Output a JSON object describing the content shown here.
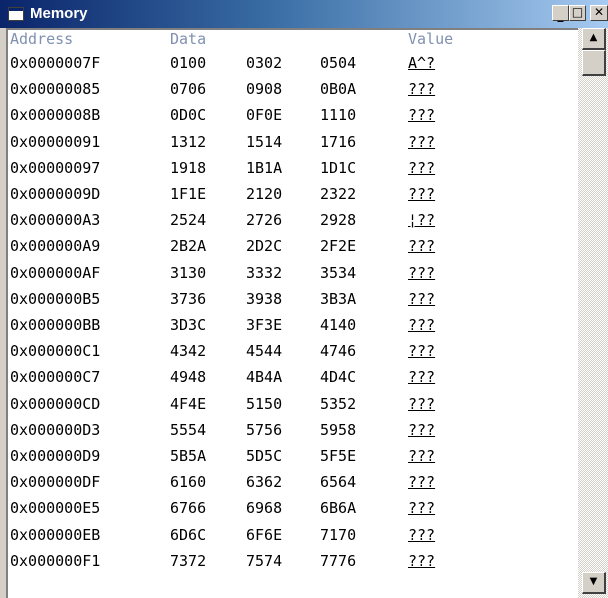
{
  "window": {
    "title": "Memory",
    "minimize_glyph": "_",
    "maximize_glyph": "□",
    "close_glyph": "✕"
  },
  "header": {
    "address": "Address",
    "data": "Data",
    "value": "Value"
  },
  "rows": [
    {
      "address": "0x0000007F",
      "d1": "0100",
      "d2": "0302",
      "d3": "0504",
      "value": "A^?"
    },
    {
      "address": "0x00000085",
      "d1": "0706",
      "d2": "0908",
      "d3": "0B0A",
      "value": "???"
    },
    {
      "address": "0x0000008B",
      "d1": "0D0C",
      "d2": "0F0E",
      "d3": "1110",
      "value": "???"
    },
    {
      "address": "0x00000091",
      "d1": "1312",
      "d2": "1514",
      "d3": "1716",
      "value": "???"
    },
    {
      "address": "0x00000097",
      "d1": "1918",
      "d2": "1B1A",
      "d3": "1D1C",
      "value": "???"
    },
    {
      "address": "0x0000009D",
      "d1": "1F1E",
      "d2": "2120",
      "d3": "2322",
      "value": "???"
    },
    {
      "address": "0x000000A3",
      "d1": "2524",
      "d2": "2726",
      "d3": "2928",
      "value": "¦??"
    },
    {
      "address": "0x000000A9",
      "d1": "2B2A",
      "d2": "2D2C",
      "d3": "2F2E",
      "value": "???"
    },
    {
      "address": "0x000000AF",
      "d1": "3130",
      "d2": "3332",
      "d3": "3534",
      "value": "???"
    },
    {
      "address": "0x000000B5",
      "d1": "3736",
      "d2": "3938",
      "d3": "3B3A",
      "value": "???"
    },
    {
      "address": "0x000000BB",
      "d1": "3D3C",
      "d2": "3F3E",
      "d3": "4140",
      "value": "???"
    },
    {
      "address": "0x000000C1",
      "d1": "4342",
      "d2": "4544",
      "d3": "4746",
      "value": "???"
    },
    {
      "address": "0x000000C7",
      "d1": "4948",
      "d2": "4B4A",
      "d3": "4D4C",
      "value": "???"
    },
    {
      "address": "0x000000CD",
      "d1": "4F4E",
      "d2": "5150",
      "d3": "5352",
      "value": "???"
    },
    {
      "address": "0x000000D3",
      "d1": "5554",
      "d2": "5756",
      "d3": "5958",
      "value": "???"
    },
    {
      "address": "0x000000D9",
      "d1": "5B5A",
      "d2": "5D5C",
      "d3": "5F5E",
      "value": "???"
    },
    {
      "address": "0x000000DF",
      "d1": "6160",
      "d2": "6362",
      "d3": "6564",
      "value": "???"
    },
    {
      "address": "0x000000E5",
      "d1": "6766",
      "d2": "6968",
      "d3": "6B6A",
      "value": "???"
    },
    {
      "address": "0x000000EB",
      "d1": "6D6C",
      "d2": "6F6E",
      "d3": "7170",
      "value": "???"
    },
    {
      "address": "0x000000F1",
      "d1": "7372",
      "d2": "7574",
      "d3": "7776",
      "value": "???"
    }
  ],
  "scrollbar": {
    "up_glyph": "▲",
    "down_glyph": "▼"
  }
}
